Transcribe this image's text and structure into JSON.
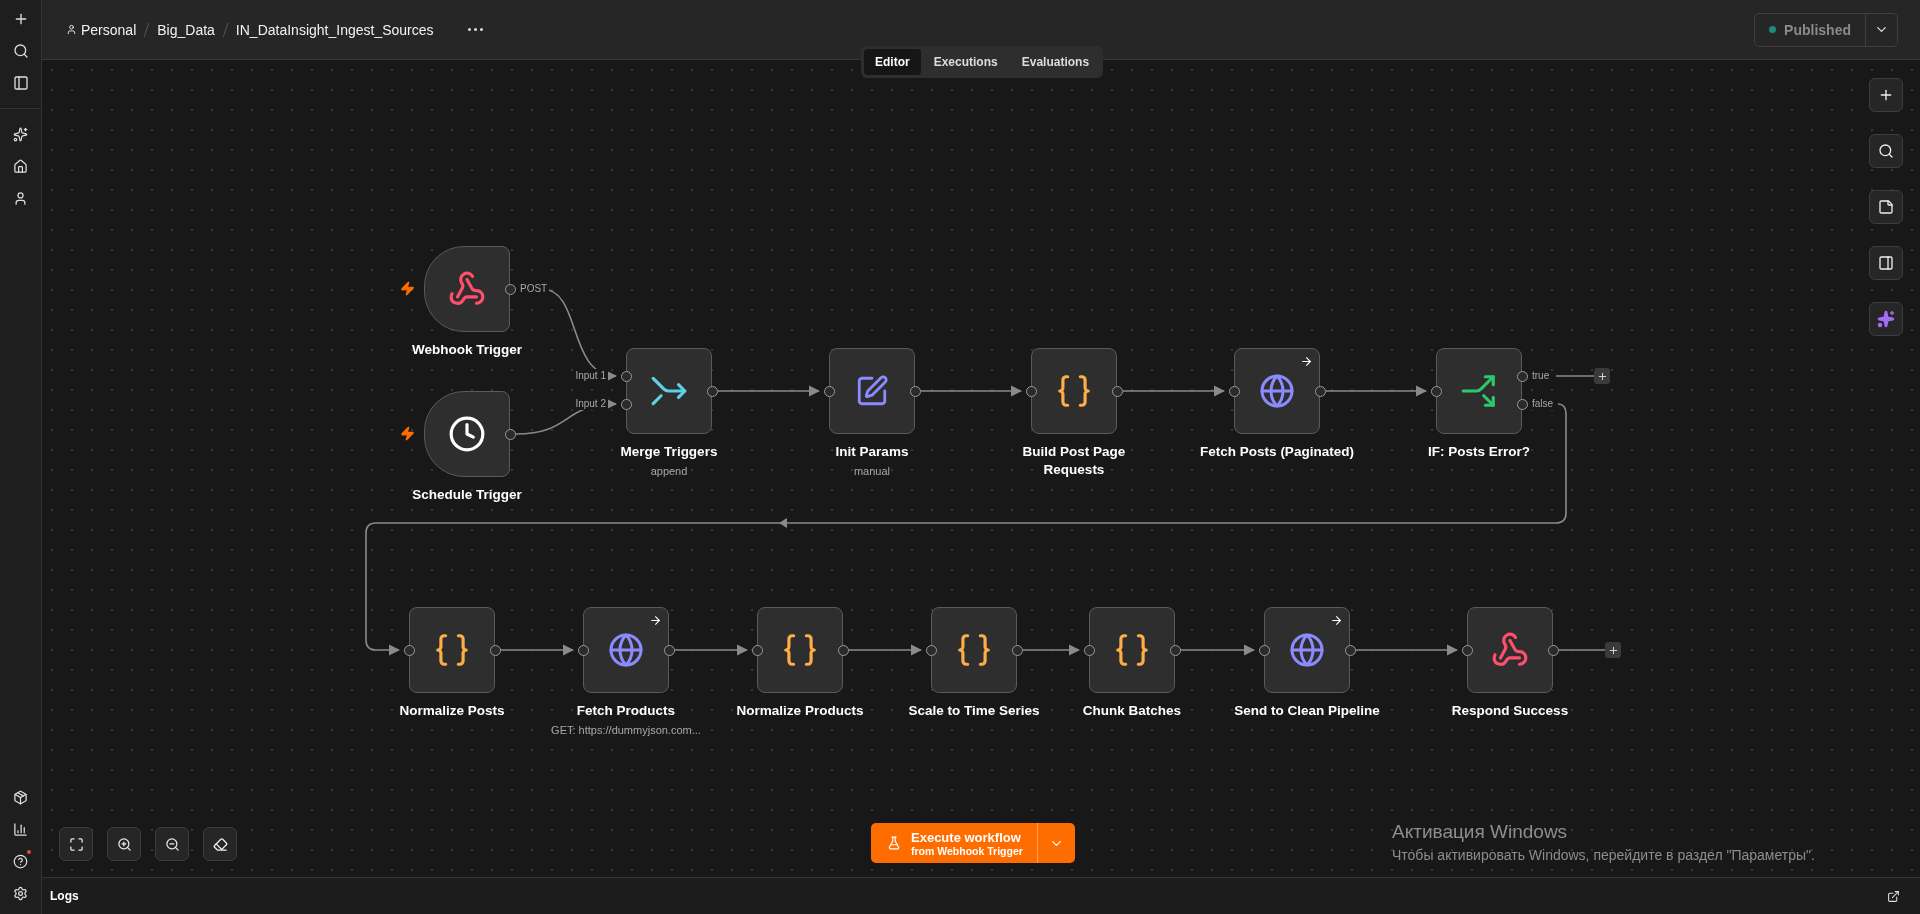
{
  "breadcrumb": [
    "Personal",
    "Big_Data",
    "IN_DataInsight_Ingest_Sources"
  ],
  "tabs": [
    {
      "label": "Editor",
      "selected": true
    },
    {
      "label": "Executions",
      "selected": false
    },
    {
      "label": "Evaluations",
      "selected": false
    }
  ],
  "publish_button": {
    "label": "Published"
  },
  "nodes": [
    {
      "kind": "webhook",
      "label": "Webhook Trigger",
      "output_labels": [
        "POST"
      ]
    },
    {
      "kind": "schedule",
      "label": "Schedule Trigger"
    },
    {
      "kind": "merge",
      "label": "Merge Triggers",
      "subtitle": "append",
      "input_labels": [
        "Input 1",
        "Input 2"
      ]
    },
    {
      "kind": "set",
      "label": "Init Params",
      "subtitle": "manual"
    },
    {
      "kind": "code",
      "label": "Build Post Page\nRequests"
    },
    {
      "kind": "http",
      "label": "Fetch Posts (Paginated)"
    },
    {
      "kind": "if",
      "label": "IF: Posts Error?",
      "output_labels": [
        "true",
        "false"
      ]
    },
    {
      "kind": "code",
      "label": "Normalize Posts"
    },
    {
      "kind": "http",
      "label": "Fetch Products",
      "subtitle": "GET: https://dummyjson.com..."
    },
    {
      "kind": "code",
      "label": "Normalize Products"
    },
    {
      "kind": "code",
      "label": "Scale to Time Series"
    },
    {
      "kind": "code",
      "label": "Chunk Batches"
    },
    {
      "kind": "http",
      "label": "Send to Clean Pipeline"
    },
    {
      "kind": "respond",
      "label": "Respond Success"
    }
  ],
  "execute_button": {
    "label": "Execute workflow",
    "subtitle": "from Webhook Trigger"
  },
  "windows_notice": {
    "title": "Активация Windows",
    "text": "Чтобы активировать Windows, перейдите в раздел \"Параметры\"."
  },
  "logs_bar": {
    "label": "Logs"
  }
}
